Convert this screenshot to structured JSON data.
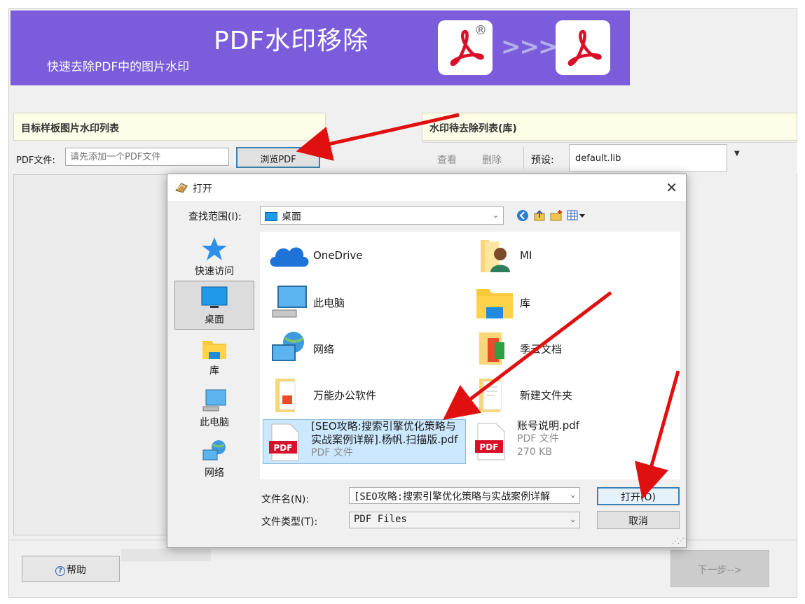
{
  "banner": {
    "title": "PDF水印移除",
    "subtitle": "快速去除PDF中的图片水印",
    "arrows": ">>>",
    "reg_mark": "®"
  },
  "left_panel": {
    "heading": "目标样板图片水印列表",
    "pdf_label": "PDF文件:",
    "pdf_placeholder": "请先添加一个PDF文件",
    "browse_label": "浏览PDF"
  },
  "right_panel": {
    "heading": "水印待去除列表(库)",
    "view_label": "查看",
    "delete_label": "删除",
    "preset_label": "预设:",
    "preset_value": "default.lib"
  },
  "bottom": {
    "help_label": "帮助",
    "next_label": "下一步-->"
  },
  "dialog": {
    "title": "打开",
    "close": "✕",
    "lookin_label": "查找范围(I):",
    "lookin_value": "桌面",
    "places": [
      {
        "label": "快速访问",
        "icon": "star-icon"
      },
      {
        "label": "桌面",
        "icon": "desktop-icon"
      },
      {
        "label": "库",
        "icon": "library-icon"
      },
      {
        "label": "此电脑",
        "icon": "computer-icon"
      },
      {
        "label": "网络",
        "icon": "network-icon"
      }
    ],
    "files": [
      {
        "name": "OneDrive",
        "icon": "cloud-icon"
      },
      {
        "name": "MI",
        "icon": "user-folder-icon"
      },
      {
        "name": "此电脑",
        "icon": "computer-icon"
      },
      {
        "name": "库",
        "icon": "library-icon"
      },
      {
        "name": "网络",
        "icon": "network-icon"
      },
      {
        "name": "季云文档",
        "icon": "folder-icon"
      },
      {
        "name": "万能办公软件",
        "icon": "folder-icon"
      },
      {
        "name": "新建文件夹",
        "icon": "folder-icon"
      },
      {
        "name_line1": "[SEO攻略:搜索引擎优化策略与",
        "name_line2": "实战案例详解].杨帆.扫描版.pdf",
        "type": "PDF 文件",
        "icon": "pdf-file-icon",
        "selected": true
      },
      {
        "name_line1": "账号说明.pdf",
        "type": "PDF 文件",
        "size": "270 KB",
        "icon": "pdf-file-icon"
      }
    ],
    "filename_label": "文件名(N):",
    "filename_value": "[SEO攻略:搜索引擎优化策略与实战案例详解",
    "filetype_label": "文件类型(T):",
    "filetype_value": "PDF Files",
    "open_label": "打开(O)",
    "cancel_label": "取消"
  },
  "colors": {
    "banner": "#7b5ddb",
    "pdf_red": "#d8102a",
    "annotation_arrow": "#e01010",
    "selection": "#cce8ff"
  }
}
